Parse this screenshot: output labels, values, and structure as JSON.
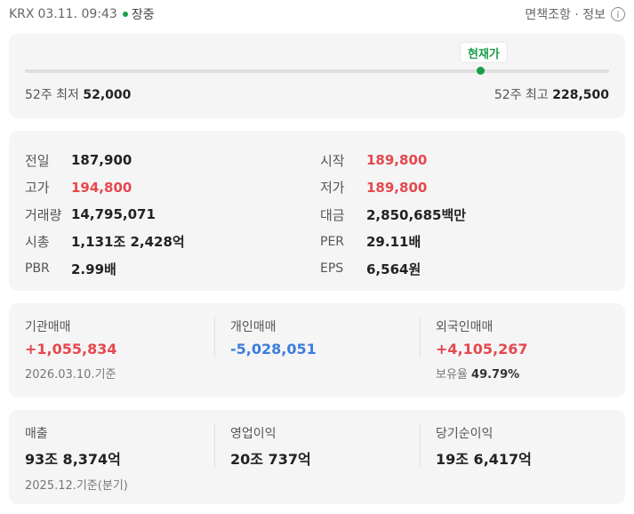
{
  "header": {
    "exchange": "KRX",
    "datetime": "03.11. 09:43",
    "status": "장중",
    "disclaimer": "면책조항 · 정보",
    "info_glyph": "i"
  },
  "range52": {
    "badge": "현재가",
    "low_label": "52주 최저",
    "low_value": "52,000",
    "high_label": "52주 최고",
    "high_value": "228,500",
    "current_fraction": 0.78
  },
  "stats": {
    "left": [
      {
        "label": "전일",
        "value": "187,900",
        "color": "default"
      },
      {
        "label": "고가",
        "value": "194,800",
        "color": "red"
      },
      {
        "label": "거래량",
        "value": "14,795,071",
        "color": "default"
      },
      {
        "label": "시총",
        "value": "1,131조 2,428억",
        "color": "default"
      },
      {
        "label": "PBR",
        "value": "2.99배",
        "color": "default"
      }
    ],
    "right": [
      {
        "label": "시작",
        "value": "189,800",
        "color": "red"
      },
      {
        "label": "저가",
        "value": "189,800",
        "color": "red"
      },
      {
        "label": "대금",
        "value": "2,850,685백만",
        "color": "default"
      },
      {
        "label": "PER",
        "value": "29.11배",
        "color": "default"
      },
      {
        "label": "EPS",
        "value": "6,564원",
        "color": "default"
      }
    ]
  },
  "trading": {
    "institution_label": "기관매매",
    "institution_value": "+1,055,834",
    "individual_label": "개인매매",
    "individual_value": "-5,028,051",
    "foreign_label": "외국인매매",
    "foreign_value": "+4,105,267",
    "date_note": "2026.03.10.기준",
    "holding_label": "보유율",
    "holding_value": "49.79%"
  },
  "financials": {
    "revenue_label": "매출",
    "revenue_value": "93조 8,374억",
    "op_income_label": "영업이익",
    "op_income_value": "20조 737억",
    "net_income_label": "당기순이익",
    "net_income_value": "19조 6,417억",
    "date_note": "2025.12.기준(분기)"
  },
  "colors": {
    "red": "#e5484d",
    "blue": "#3b7ddd",
    "green": "#1a9e49"
  }
}
